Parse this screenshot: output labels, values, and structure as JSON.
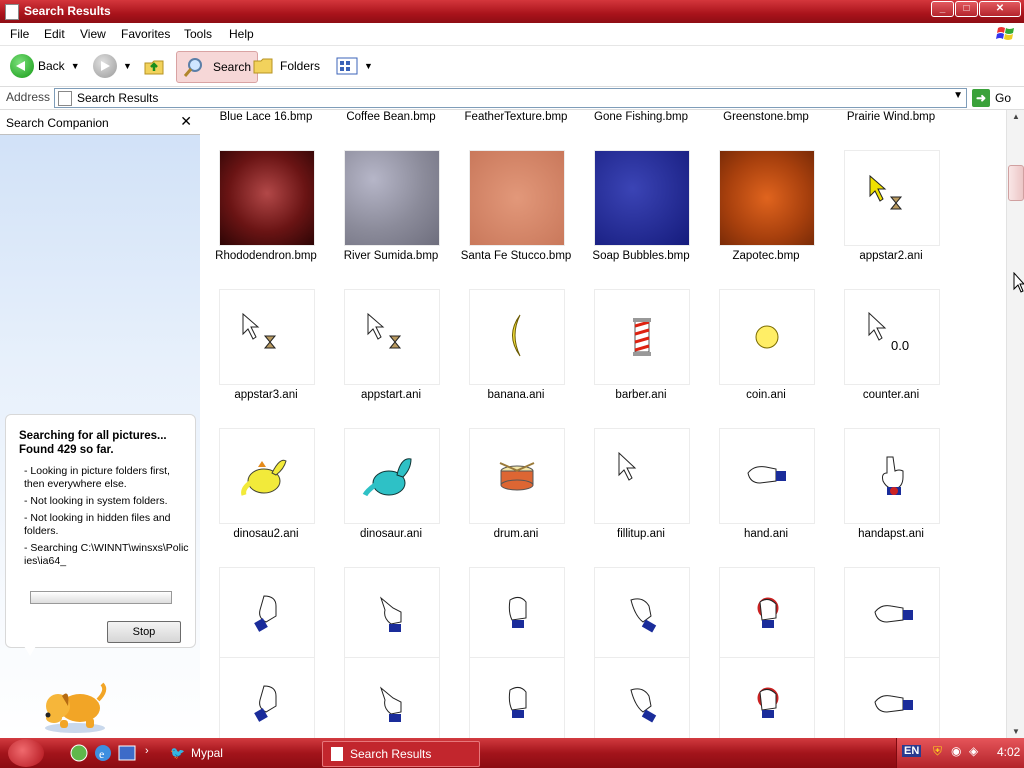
{
  "window": {
    "title": "Search Results"
  },
  "menu": [
    "File",
    "Edit",
    "View",
    "Favorites",
    "Tools",
    "Help"
  ],
  "toolbar": {
    "back": "Back",
    "search": "Search",
    "folders": "Folders"
  },
  "address": {
    "label": "Address",
    "value": "Search Results",
    "go": "Go"
  },
  "companion": {
    "title": "Search Companion",
    "status_line1": "Searching for all pictures...",
    "status_line2": "Found 429 so far.",
    "notes": [
      "- Looking in picture folders first, then everywhere else.",
      "- Not looking in system folders.",
      "- Not looking in hidden files and folders.",
      "- Searching C:\\WINNT\\winsxs\\Policies\\ia64_"
    ],
    "stop": "Stop"
  },
  "results": {
    "row0": [
      "Blue Lace 16.bmp",
      "Coffee Bean.bmp",
      "FeatherTexture.bmp",
      "Gone Fishing.bmp",
      "Greenstone.bmp",
      "Prairie Wind.bmp"
    ],
    "row1": [
      "Rhododendron.bmp",
      "River Sumida.bmp",
      "Santa Fe Stucco.bmp",
      "Soap Bubbles.bmp",
      "Zapotec.bmp",
      "appstar2.ani"
    ],
    "row2": [
      "appstar3.ani",
      "appstart.ani",
      "banana.ani",
      "barber.ani",
      "coin.ani",
      "counter.ani"
    ],
    "row3": [
      "dinosau2.ani",
      "dinosaur.ani",
      "drum.ani",
      "fillitup.ani",
      "hand.ani",
      "handapst.ani"
    ]
  },
  "counter_text": "0.0",
  "taskbar": {
    "quick_task": "Mypal",
    "active_task": "Search Results",
    "lang": "EN",
    "clock": "4:02"
  }
}
